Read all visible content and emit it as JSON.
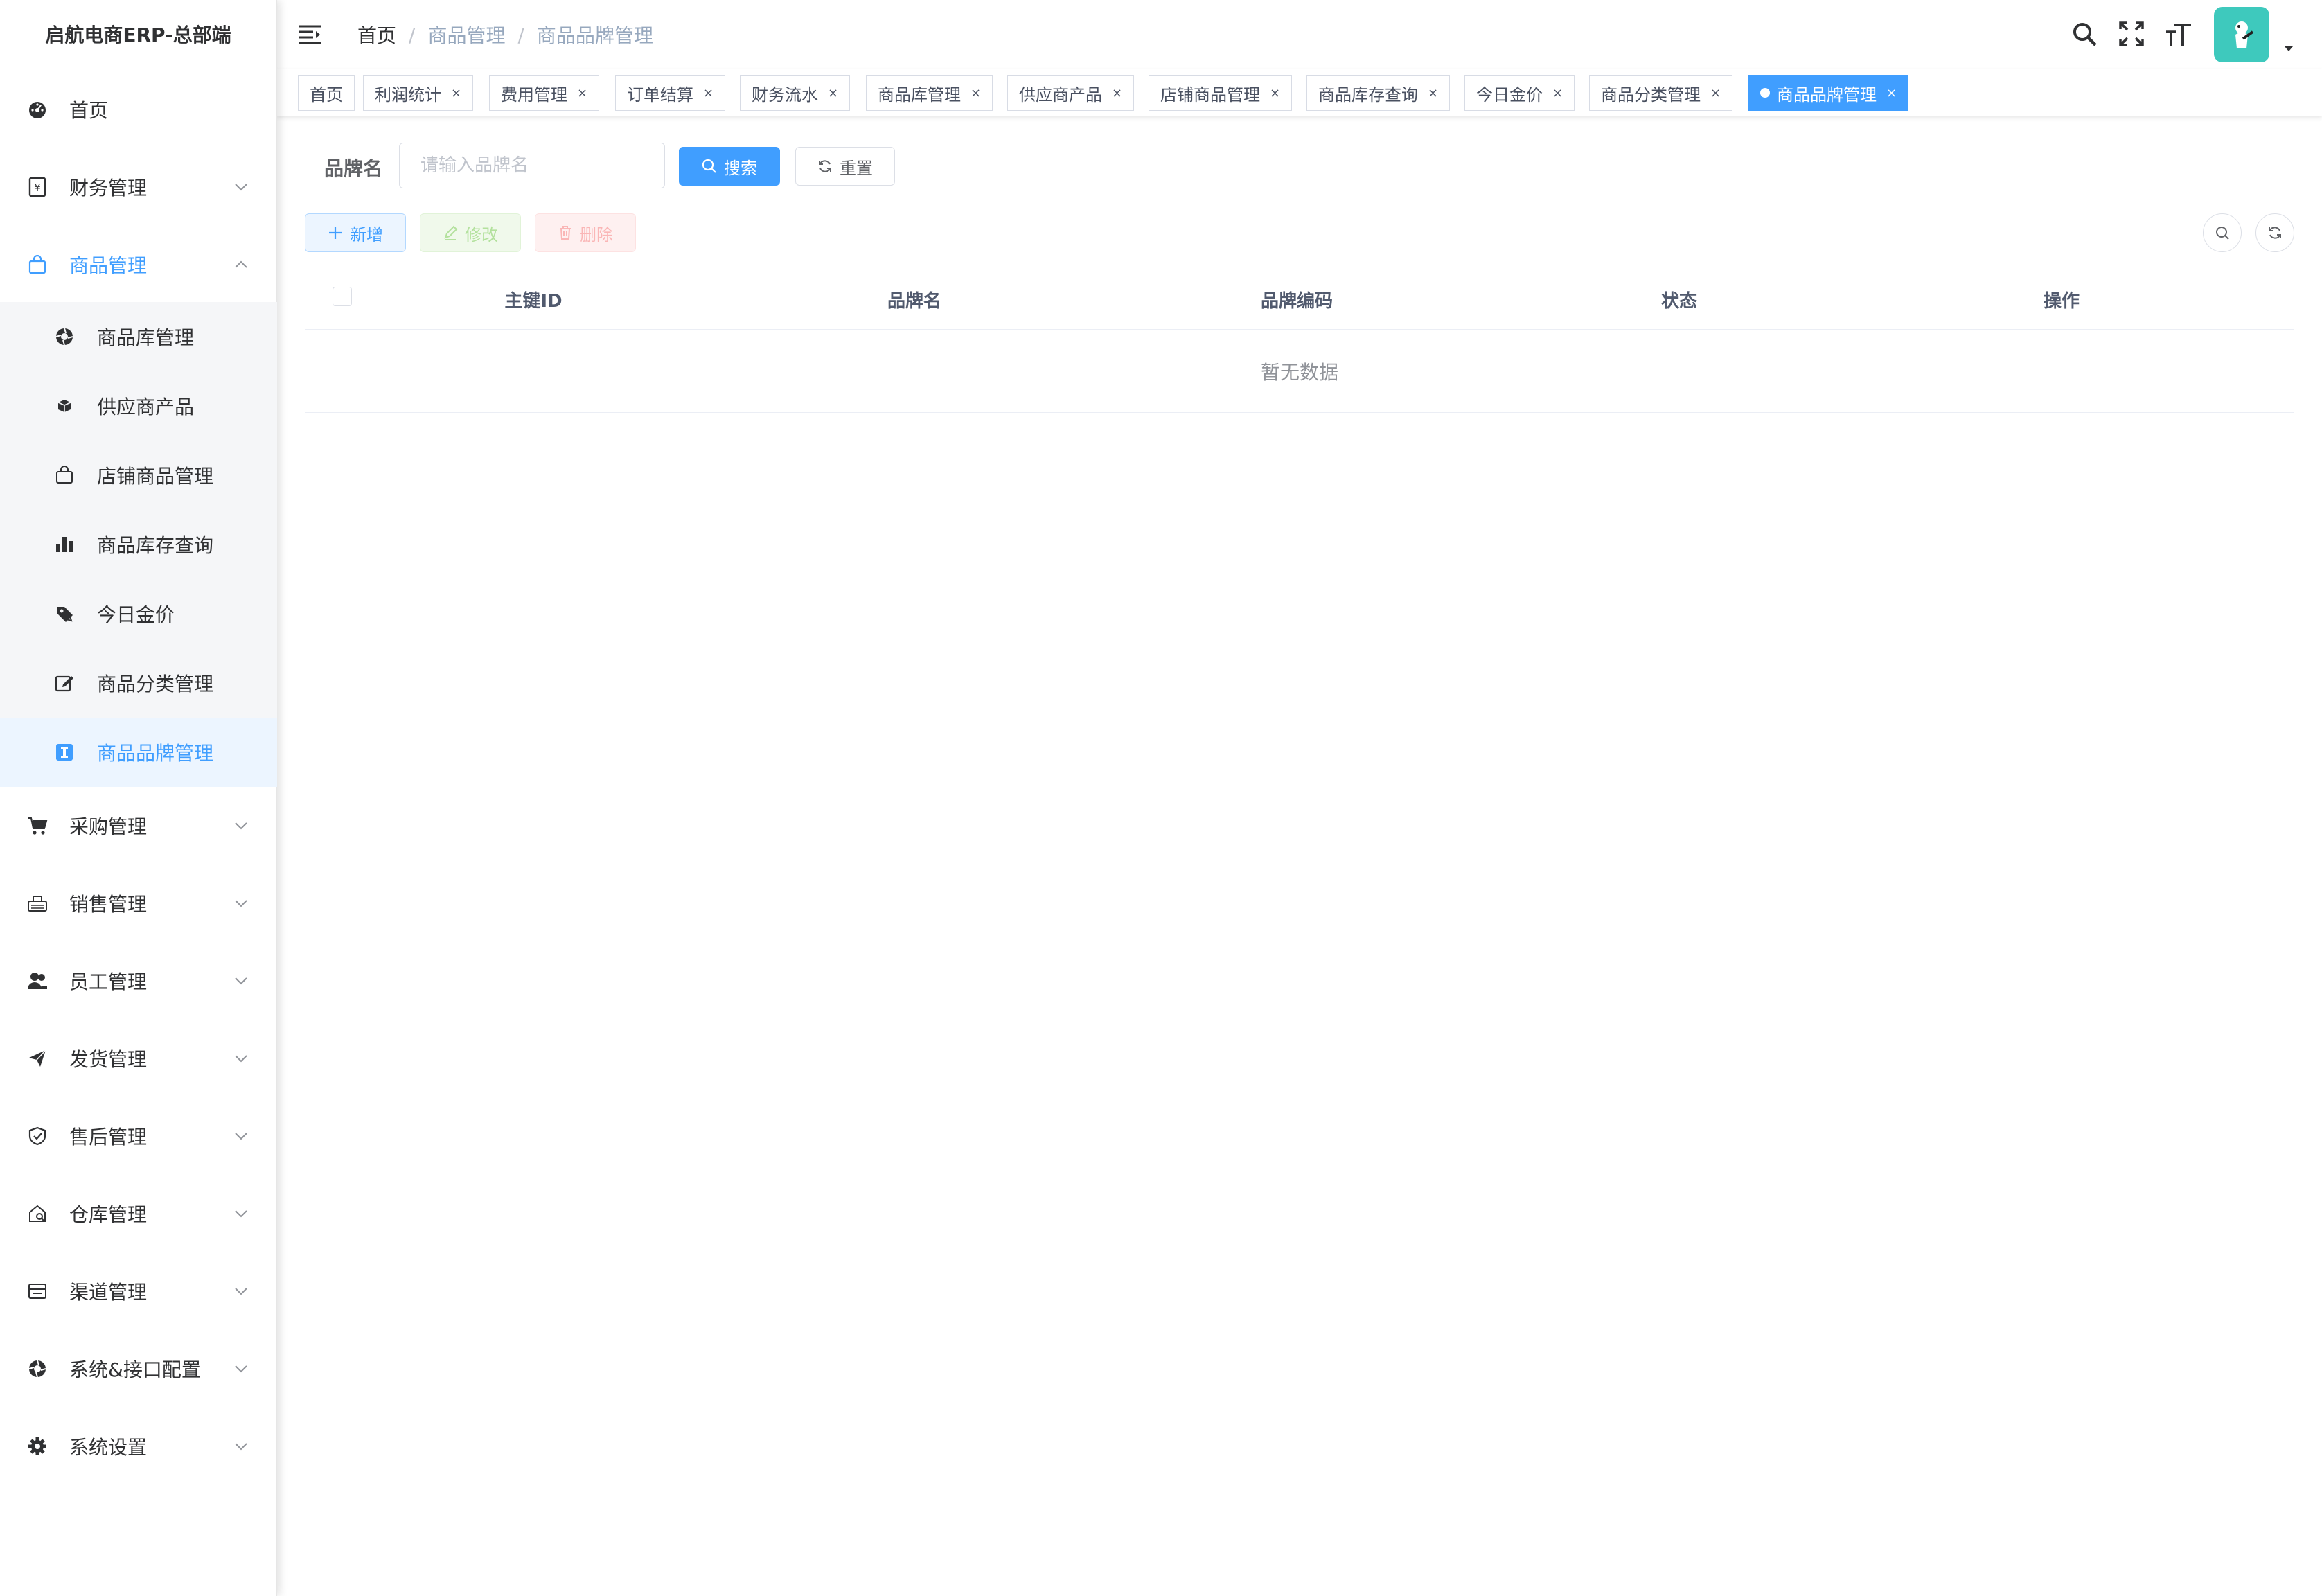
{
  "app": {
    "title": "启航电商ERP-总部端"
  },
  "sidebar": {
    "home": "首页",
    "finance": "财务管理",
    "goods": "商品管理",
    "goods_sub": {
      "library": "商品库管理",
      "supplier_products": "供应商产品",
      "shop_goods": "店铺商品管理",
      "stock_query": "商品库存查询",
      "gold_price": "今日金价",
      "category": "商品分类管理",
      "brand": "商品品牌管理"
    },
    "purchase": "采购管理",
    "sales": "销售管理",
    "staff": "员工管理",
    "shipping": "发货管理",
    "after_sales": "售后管理",
    "warehouse": "仓库管理",
    "channel": "渠道管理",
    "system_api": "系统&接口配置",
    "settings": "系统设置"
  },
  "breadcrumb": {
    "home": "首页",
    "goods": "商品管理",
    "current": "商品品牌管理",
    "separator": "/"
  },
  "tags": {
    "t0": "首页",
    "t1": "利润统计",
    "t2": "费用管理",
    "t3": "订单结算",
    "t4": "财务流水",
    "t5": "商品库管理",
    "t6": "供应商产品",
    "t7": "店铺商品管理",
    "t8": "商品库存查询",
    "t9": "今日金价",
    "t10": "商品分类管理",
    "t11": "商品品牌管理",
    "close_glyph": "×"
  },
  "search": {
    "label": "品牌名",
    "placeholder": "请输入品牌名",
    "search_btn": "搜索",
    "reset_btn": "重置"
  },
  "toolbar": {
    "add": "新增",
    "edit": "修改",
    "delete": "删除"
  },
  "table": {
    "columns": {
      "id": "主键ID",
      "name": "品牌名",
      "code": "品牌编码",
      "status": "状态",
      "actions": "操作"
    },
    "empty": "暂无数据"
  },
  "colors": {
    "primary": "#409eff",
    "avatar_bg": "#3ec9bd"
  },
  "icons": {
    "header": [
      "hamburger-icon",
      "search-icon",
      "fullscreen-icon",
      "font-size-icon",
      "avatar",
      "caret-down-icon"
    ]
  }
}
